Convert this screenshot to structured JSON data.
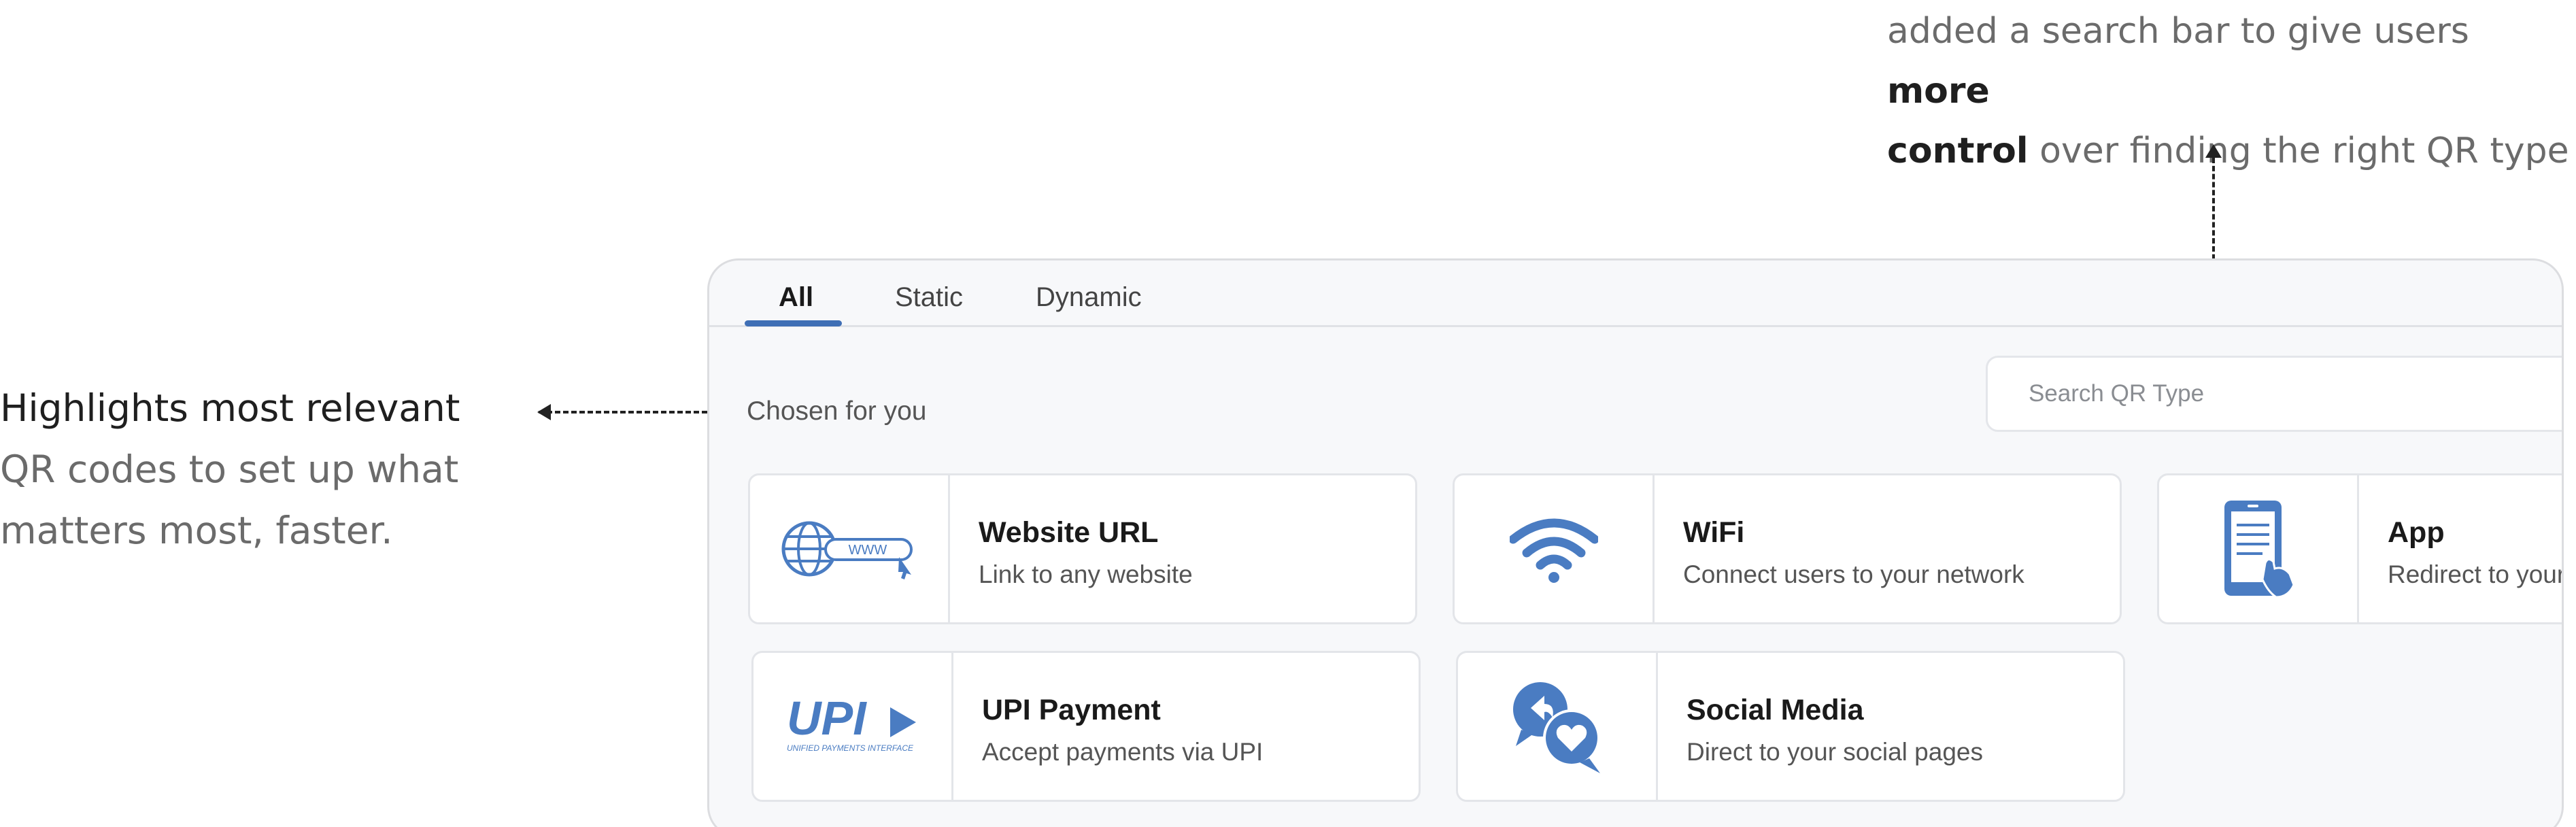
{
  "annotations": {
    "left_strong": "Highlights most relevant",
    "left_line2": "QR codes to set up what",
    "left_line3": "matters most, faster.",
    "right_part1": "added a search bar to give users ",
    "right_strong1": "more",
    "right_strong2": "control",
    "right_part2": " over finding the right QR type"
  },
  "tabs": [
    {
      "label": "All",
      "active": true
    },
    {
      "label": "Static",
      "active": false
    },
    {
      "label": "Dynamic",
      "active": false
    }
  ],
  "section": {
    "title": "Chosen for you"
  },
  "search": {
    "placeholder": "Search QR Type"
  },
  "cards": [
    {
      "title": "Website URL",
      "description": "Link to any website",
      "icon": "globe-www-icon",
      "icon_text": "WWW"
    },
    {
      "title": "WiFi",
      "description": "Connect users to your network",
      "icon": "wifi-icon"
    },
    {
      "title": "App",
      "description": "Redirect to your",
      "icon": "phone-app-icon"
    },
    {
      "title": "UPI Payment",
      "description": "Accept payments via UPI",
      "icon": "upi-logo-icon",
      "icon_text": "UPI",
      "icon_subtext": "UNIFIED PAYMENTS INTERFACE"
    },
    {
      "title": "Social Media",
      "description": "Direct to your social pages",
      "icon": "social-media-icon"
    }
  ],
  "colors": {
    "accent": "#3f6fb5",
    "icon_blue": "#4a7cc2",
    "panel_bg": "#f7f8fa",
    "border": "#dcdde0"
  }
}
